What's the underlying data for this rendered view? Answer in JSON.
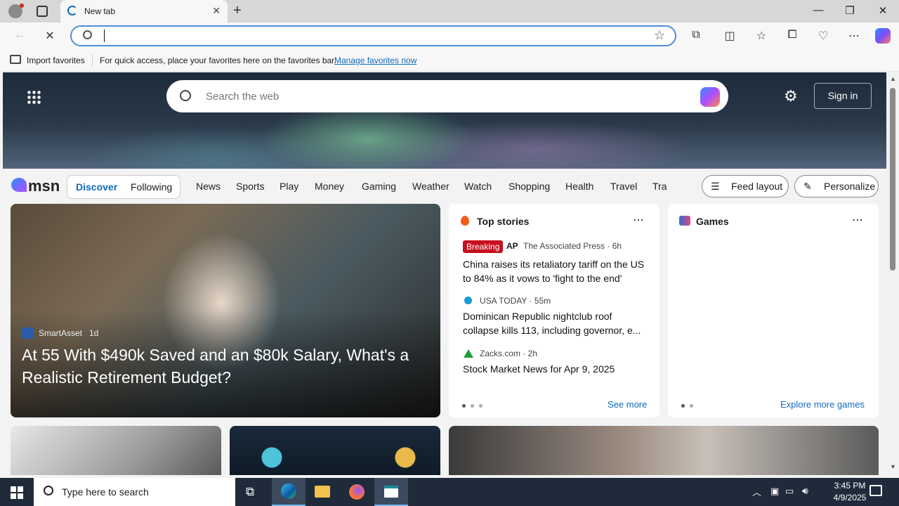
{
  "browser": {
    "tab_title": "New tab",
    "address_value": "",
    "favorites_bar": {
      "import_label": "Import favorites",
      "message": "For quick access, place your favorites here on the favorites bar.",
      "manage_link": "Manage favorites now"
    }
  },
  "msn": {
    "search_placeholder": "Search the web",
    "sign_in": "Sign in",
    "logo_text": "msn",
    "tabs": {
      "discover": "Discover",
      "following": "Following"
    },
    "nav": [
      "News",
      "Sports",
      "Play",
      "Money",
      "Gaming",
      "Weather",
      "Watch",
      "Shopping",
      "Health",
      "Travel",
      "Tra"
    ],
    "feed_layout": "Feed layout",
    "personalize": "Personalize",
    "feature": {
      "source": "SmartAsset",
      "age": "1d",
      "headline": "At 55 With $490k Saved and an $80k Salary, What's a Realistic Retirement Budget?"
    },
    "top_stories": {
      "title": "Top stories",
      "see_more": "See more",
      "items": [
        {
          "badge": "Breaking",
          "source": "The Associated Press · 6h",
          "headline": "China raises its retaliatory tariff on the US to 84% as it vows to 'fight to the end'"
        },
        {
          "source": "USA TODAY · 55m",
          "headline": "Dominican Republic nightclub roof collapse kills 113, including governor, e..."
        },
        {
          "source": "Zacks.com · 2h",
          "headline": "Stock Market News for Apr 9, 2025"
        }
      ]
    },
    "games": {
      "title": "Games",
      "explore": "Explore more games"
    }
  },
  "taskbar": {
    "search_placeholder": "Type here to search",
    "time": "3:45 PM",
    "date": "4/9/2025"
  },
  "colors": {
    "accent": "#0f6cbd",
    "breaking": "#c50f1f",
    "taskbar": "#1f2a3a"
  }
}
